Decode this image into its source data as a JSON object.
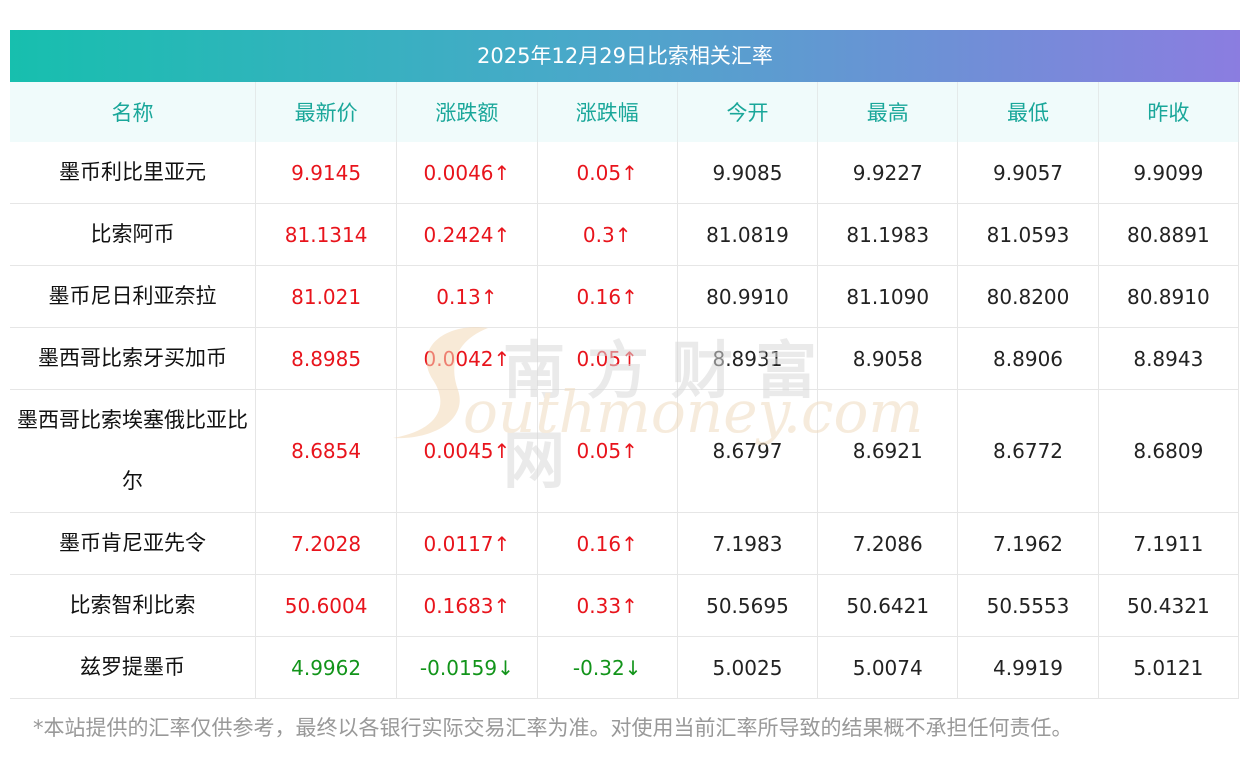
{
  "title": "2025年12月29日比索相关汇率",
  "headers": [
    "名称",
    "最新价",
    "涨跌额",
    "涨跌幅",
    "今开",
    "最高",
    "最低",
    "昨收"
  ],
  "rows": [
    {
      "name": "墨币利比里亚元",
      "latest": "9.9145",
      "change": "0.0046↑",
      "pct": "0.05↑",
      "open": "9.9085",
      "high": "9.9227",
      "low": "9.9057",
      "prev": "9.9099",
      "dir": "up"
    },
    {
      "name": "比索阿币",
      "latest": "81.1314",
      "change": "0.2424↑",
      "pct": "0.3↑",
      "open": "81.0819",
      "high": "81.1983",
      "low": "81.0593",
      "prev": "80.8891",
      "dir": "up"
    },
    {
      "name": "墨币尼日利亚奈拉",
      "latest": "81.021",
      "change": "0.13↑",
      "pct": "0.16↑",
      "open": "80.9910",
      "high": "81.1090",
      "low": "80.8200",
      "prev": "80.8910",
      "dir": "up"
    },
    {
      "name": "墨西哥比索牙买加币",
      "latest": "8.8985",
      "change": "0.0042↑",
      "pct": "0.05↑",
      "open": "8.8931",
      "high": "8.9058",
      "low": "8.8906",
      "prev": "8.8943",
      "dir": "up"
    },
    {
      "name": "墨西哥比索埃塞俄比亚比尔",
      "latest": "8.6854",
      "change": "0.0045↑",
      "pct": "0.05↑",
      "open": "8.6797",
      "high": "8.6921",
      "low": "8.6772",
      "prev": "8.6809",
      "dir": "up"
    },
    {
      "name": "墨币肯尼亚先令",
      "latest": "7.2028",
      "change": "0.0117↑",
      "pct": "0.16↑",
      "open": "7.1983",
      "high": "7.2086",
      "low": "7.1962",
      "prev": "7.1911",
      "dir": "up"
    },
    {
      "name": "比索智利比索",
      "latest": "50.6004",
      "change": "0.1683↑",
      "pct": "0.33↑",
      "open": "50.5695",
      "high": "50.6421",
      "low": "50.5553",
      "prev": "50.4321",
      "dir": "up"
    },
    {
      "name": "兹罗提墨币",
      "latest": "4.9962",
      "change": "-0.0159↓",
      "pct": "-0.32↓",
      "open": "5.0025",
      "high": "5.0074",
      "low": "4.9919",
      "prev": "5.0121",
      "dir": "down"
    }
  ],
  "watermark": {
    "cn": "南方财富网",
    "en": "outhmoney.com"
  },
  "footnote": "*本站提供的汇率仅供参考，最终以各银行实际交易汇率为准。对使用当前汇率所导致的结果概不承担任何责任。",
  "colors": {
    "up": "#e8141c",
    "down": "#12941a",
    "header_text": "#1aa79a",
    "gradient_start": "#17bfae",
    "gradient_end": "#8b7de0"
  }
}
